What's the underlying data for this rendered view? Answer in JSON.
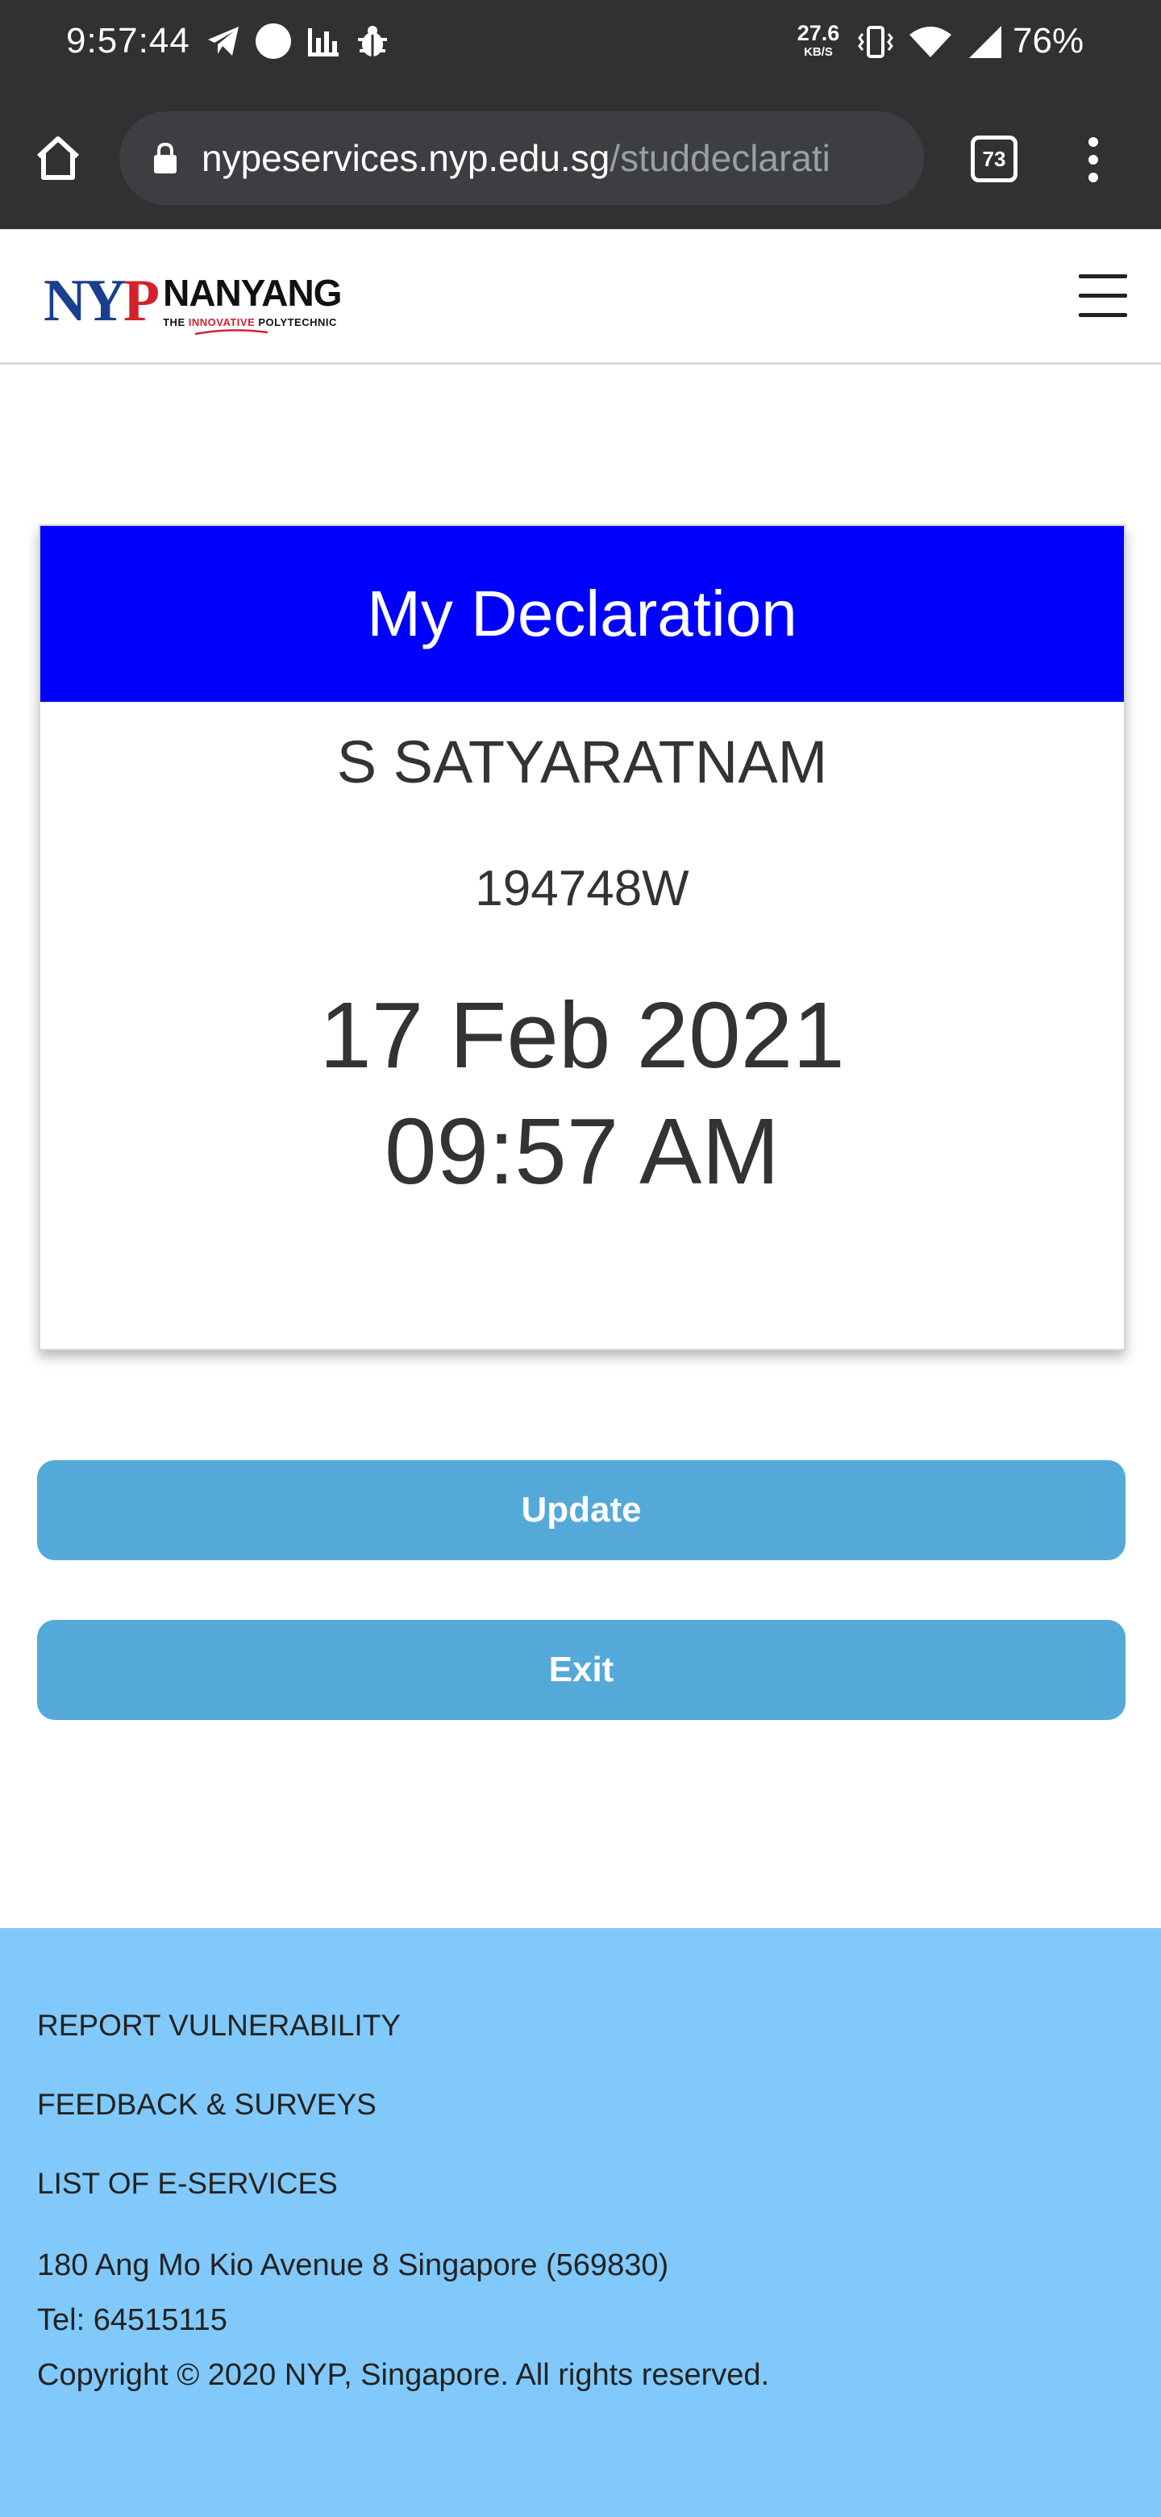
{
  "status_bar": {
    "time": "9:57:44",
    "net_speed_value": "27.6",
    "net_speed_unit": "KB/S",
    "battery": "76%",
    "left_icons": [
      "telegram-icon",
      "circle-icon",
      "bar-chart-icon",
      "bug-icon"
    ],
    "right_icons": [
      "vibrate-icon",
      "wifi-icon",
      "cell-signal-icon"
    ]
  },
  "browser": {
    "url_domain": "nypeservices.nyp.edu.sg",
    "url_path": "/studdeclarati",
    "tab_count": "73"
  },
  "site": {
    "logo_mark_n": "N",
    "logo_mark_y": "Y",
    "logo_mark_p": "P",
    "logo_name": "NANYANG",
    "logo_tag_pre": "THE ",
    "logo_tag_innov": "INNOVATIVE",
    "logo_tag_post": " POLYTECHNIC"
  },
  "declaration": {
    "title": "My Declaration",
    "name": "S SATYARATNAM",
    "id": "194748W",
    "date": "17 Feb 2021",
    "time": "09:57 AM"
  },
  "actions": {
    "update_label": "Update",
    "exit_label": "Exit"
  },
  "footer": {
    "links": [
      "REPORT VULNERABILITY",
      "FEEDBACK & SURVEYS",
      "LIST OF E-SERVICES"
    ],
    "address": "180 Ang Mo Kio Avenue 8 Singapore (569830)",
    "tel": "Tel: 64515115",
    "copyright": "Copyright © 2020 NYP, Singapore. All rights reserved."
  },
  "colors": {
    "status_bar_bg": "#2f3133",
    "card_header_bg": "#0000ff",
    "button_bg": "#54a9d8",
    "footer_bg": "#81c9fa",
    "brand_blue": "#1b3f8f",
    "brand_red": "#d4212c"
  }
}
